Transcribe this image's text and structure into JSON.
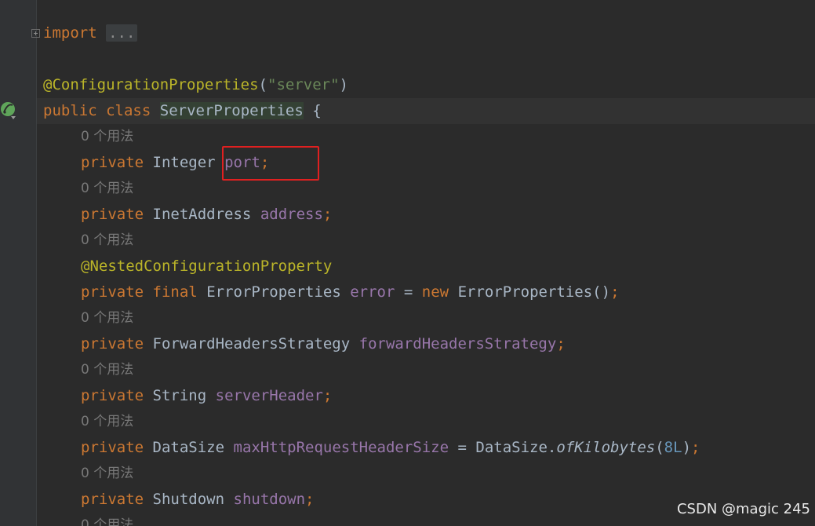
{
  "code": {
    "import_keyword": "import",
    "import_folded": "...",
    "annotation_class": "@ConfigurationProperties",
    "annotation_paren_open": "(",
    "annotation_arg": "\"server\"",
    "annotation_paren_close": ")",
    "public_kw": "public",
    "class_kw": "class",
    "class_name": "ServerProperties",
    "brace_open": "{",
    "usage_hint": "0 个用法",
    "private_kw": "private",
    "final_kw": "final",
    "new_kw": "new",
    "port_type": "Integer",
    "port_name": "port",
    "address_type": "InetAddress",
    "address_name": "address",
    "nested_annotation": "@NestedConfigurationProperty",
    "error_type": "ErrorProperties",
    "error_name": "error",
    "error_ctor": "ErrorProperties",
    "fhs_type": "ForwardHeadersStrategy",
    "fhs_name": "forwardHeadersStrategy",
    "server_header_type": "String",
    "server_header_name": "serverHeader",
    "max_header_type": "DataSize",
    "max_header_name": "maxHttpRequestHeaderSize",
    "datasize_class": "DataSize",
    "of_kilobytes": "ofKilobytes",
    "eight_l": "8L",
    "shutdown_type": "Shutdown",
    "shutdown_name": "shutdown",
    "usage_hint_partial": "0 个用法"
  },
  "watermark": "CSDN @magic 245",
  "colors": {
    "background": "#2b2b2b",
    "keyword": "#cc7832",
    "annotation": "#bbb529",
    "string": "#6a8759",
    "field": "#9876aa",
    "highlight_border": "#e02020"
  },
  "icons": {
    "gutter": "spring-bean-icon",
    "fold": "fold-expand-icon"
  }
}
